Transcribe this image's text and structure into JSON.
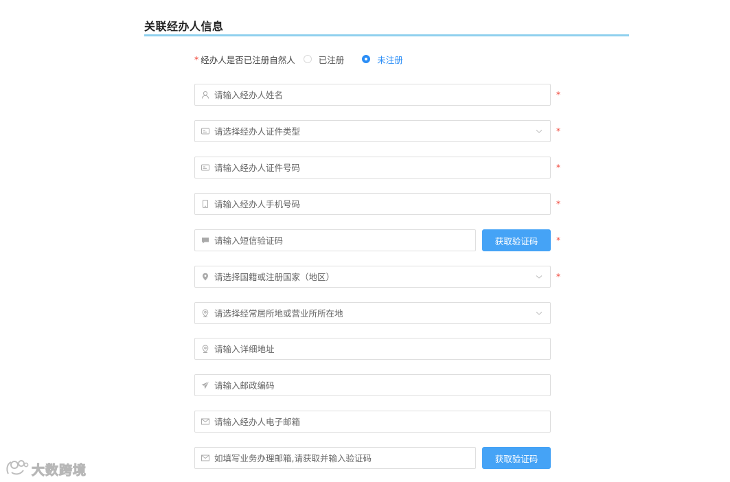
{
  "section": {
    "title": "关联经办人信息"
  },
  "registration": {
    "required_mark": "*",
    "label": "经办人是否已注册自然人",
    "options": [
      {
        "label": "已注册",
        "checked": false
      },
      {
        "label": "未注册",
        "checked": true
      }
    ]
  },
  "form": {
    "required_mark": "*",
    "name": {
      "placeholder": "请输入经办人姓名",
      "icon": "user-icon"
    },
    "id_type": {
      "placeholder": "请选择经办人证件类型",
      "icon": "id-card-icon"
    },
    "id_number": {
      "placeholder": "请输入经办人证件号码",
      "icon": "id-card-icon"
    },
    "phone": {
      "placeholder": "请输入经办人手机号码",
      "icon": "mobile-icon"
    },
    "sms_code": {
      "placeholder": "请输入短信验证码",
      "icon": "message-icon",
      "button": "获取验证码"
    },
    "nationality": {
      "placeholder": "请选择国籍或注册国家（地区）",
      "icon": "location-icon"
    },
    "residence": {
      "placeholder": "请选择经常居所地或营业所所在地",
      "icon": "location-icon"
    },
    "address": {
      "placeholder": "请输入详细地址",
      "icon": "location-icon"
    },
    "postal_code": {
      "placeholder": "请输入邮政编码",
      "icon": "send-icon"
    },
    "email": {
      "placeholder": "请输入经办人电子邮箱",
      "icon": "mail-icon"
    },
    "business_email": {
      "placeholder": "如填写业务办理邮箱,请获取并输入验证码",
      "icon": "mail-icon",
      "button": "获取验证码"
    }
  },
  "watermark": {
    "text": "大数跨境"
  },
  "colors": {
    "primary": "#45a3f6",
    "required": "#f04134",
    "accent_line": "#8fd0ee"
  }
}
